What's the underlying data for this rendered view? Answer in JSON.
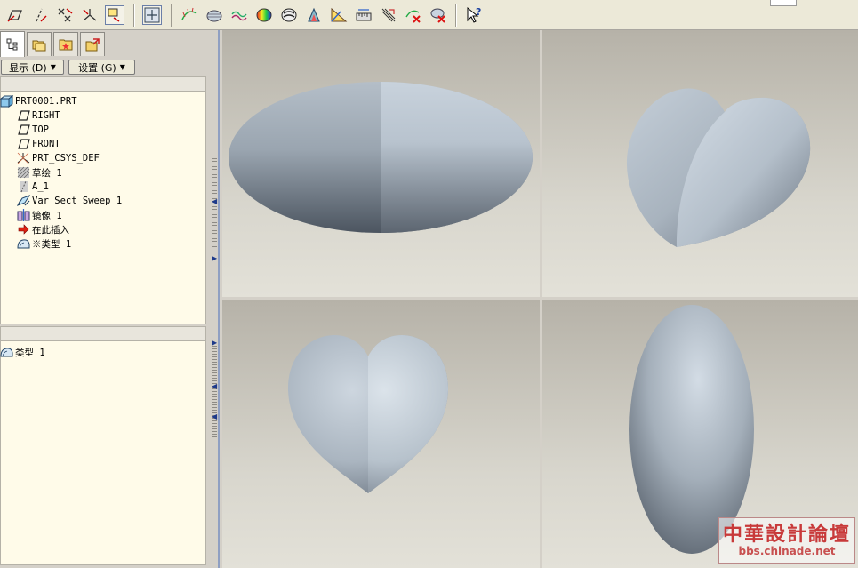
{
  "toolbar": {
    "buttons": [
      {
        "icon": "datum-plane-display-icon"
      },
      {
        "icon": "datum-axis-display-icon"
      },
      {
        "icon": "datum-point-display-icon"
      },
      {
        "icon": "coordinate-system-display-icon"
      },
      {
        "icon": "annotation-display-icon"
      },
      {
        "icon": "view-spin-center-icon"
      },
      {
        "icon": "curve-analysis-icon"
      },
      {
        "icon": "section-analysis-icon"
      },
      {
        "icon": "offset-analysis-icon"
      },
      {
        "icon": "shaded-curvature-icon"
      },
      {
        "icon": "reflection-analysis-icon"
      },
      {
        "icon": "draft-analysis-icon"
      },
      {
        "icon": "dihedral-analysis-icon"
      },
      {
        "icon": "measure-icon"
      },
      {
        "icon": "curve-mesh-icon"
      },
      {
        "icon": "delete-curve-analysis-icon"
      },
      {
        "icon": "delete-surface-analysis-icon"
      },
      {
        "icon": "context-help-icon"
      }
    ]
  },
  "left_panel": {
    "tabs": [
      {
        "icon": "model-tree-icon"
      },
      {
        "icon": "folder-browser-icon"
      },
      {
        "icon": "favorites-icon"
      },
      {
        "icon": "connections-icon"
      }
    ],
    "menus": [
      {
        "label": "显示 (D)"
      },
      {
        "label": "设置 (G)"
      }
    ],
    "tree": [
      {
        "label": "PRT0001.PRT",
        "icon": "part-icon",
        "indent": 0
      },
      {
        "label": "RIGHT",
        "icon": "datum-plane-icon",
        "indent": 1
      },
      {
        "label": "TOP",
        "icon": "datum-plane-icon",
        "indent": 1
      },
      {
        "label": "FRONT",
        "icon": "datum-plane-icon",
        "indent": 1
      },
      {
        "label": "PRT_CSYS_DEF",
        "icon": "coordinate-system-icon",
        "indent": 1
      },
      {
        "label": "草绘 1",
        "icon": "sketch-icon",
        "indent": 1
      },
      {
        "label": "A_1",
        "icon": "datum-axis-icon",
        "indent": 1
      },
      {
        "label": "Var Sect Sweep 1",
        "icon": "var-sect-sweep-icon",
        "indent": 1
      },
      {
        "label": "镜像 1",
        "icon": "mirror-icon",
        "indent": 1
      },
      {
        "label": "在此插入",
        "icon": "insert-here-arrow-icon",
        "indent": 1
      },
      {
        "label": "※类型 1",
        "icon": "analysis-feature-icon",
        "indent": 1
      }
    ],
    "detail": [
      {
        "label": "类型 1",
        "icon": "analysis-feature-icon"
      }
    ]
  },
  "viewports": {
    "surface_color": "#9eaab5"
  },
  "watermark": {
    "title": "中華設計論壇",
    "url": "bbs.chinade.net"
  }
}
